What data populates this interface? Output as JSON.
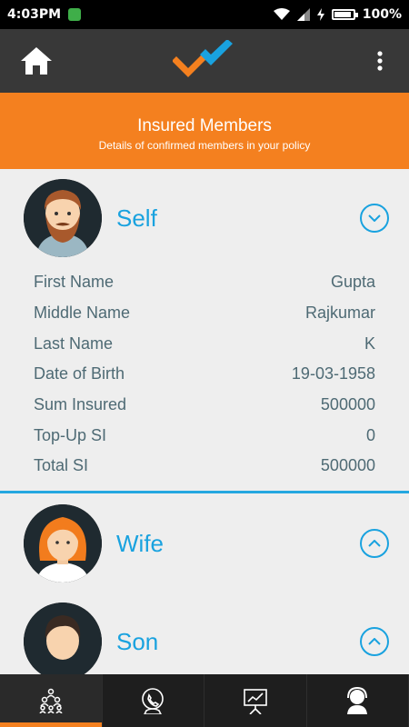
{
  "status_bar": {
    "time": "4:03PM",
    "battery": "100%"
  },
  "header": {
    "title": "Insured Members",
    "subtitle": "Details of confirmed members in your policy"
  },
  "colors": {
    "accent_orange": "#f4801f",
    "accent_blue": "#19a2df",
    "app_bar": "#383838"
  },
  "members": [
    {
      "name": "Self",
      "icon": "male-bearded-avatar-icon",
      "expanded": true,
      "details": [
        {
          "label": "First Name",
          "value": "Gupta"
        },
        {
          "label": "Middle Name",
          "value": "Rajkumar"
        },
        {
          "label": "Last Name",
          "value": "K"
        },
        {
          "label": "Date of Birth",
          "value": "19-03-1958"
        },
        {
          "label": "Sum Insured",
          "value": "500000"
        },
        {
          "label": "Top-Up SI",
          "value": "0"
        },
        {
          "label": "Total SI",
          "value": "500000"
        }
      ]
    },
    {
      "name": "Wife",
      "icon": "female-avatar-icon",
      "expanded": false
    },
    {
      "name": "Son",
      "icon": "boy-avatar-icon",
      "expanded": false
    }
  ],
  "bottom_nav": [
    {
      "icon": "members-icon",
      "active": true
    },
    {
      "icon": "call-support-icon",
      "active": false
    },
    {
      "icon": "presentation-chart-icon",
      "active": false
    },
    {
      "icon": "agent-headset-icon",
      "active": false
    }
  ]
}
